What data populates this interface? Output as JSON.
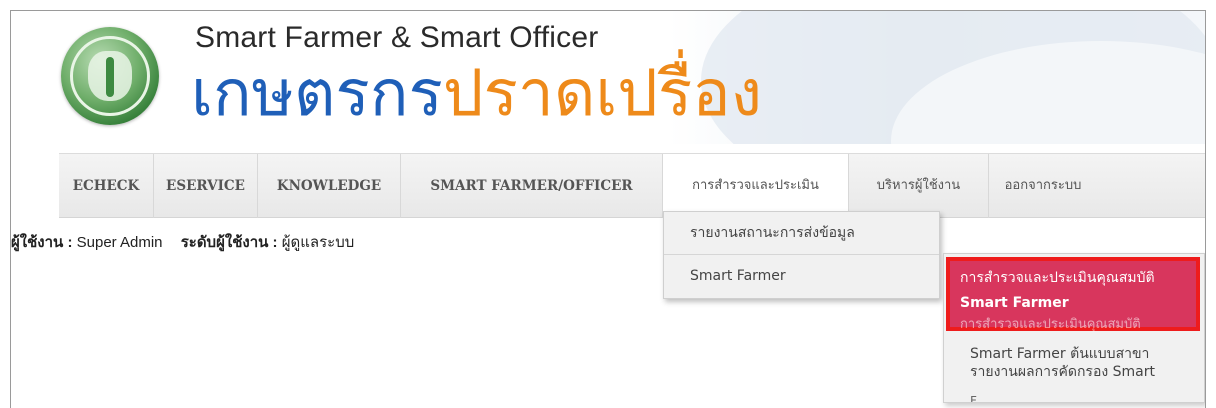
{
  "header": {
    "title_en": "Smart Farmer & Smart Officer",
    "title_th_part1": "เกษตรกร",
    "title_th_part2": "ปราดเปรื่อง",
    "logo_icon": "agriculture-department-seal-icon"
  },
  "nav": {
    "items": [
      {
        "label": "ECHECK"
      },
      {
        "label": "ESERVICE"
      },
      {
        "label": "KNOWLEDGE"
      },
      {
        "label": "SMART FARMER/OFFICER"
      },
      {
        "label": "การสำรวจและประเมิน"
      },
      {
        "label": "บริหารผู้ใช้งาน"
      },
      {
        "label": "ออกจากระบบ"
      }
    ]
  },
  "user": {
    "user_label": "ผู้ใช้งาน :",
    "user_value": "Super Admin",
    "level_label": "ระดับผู้ใช้งาน :",
    "level_value": "ผู้ดูแลระบบ"
  },
  "dropdown": {
    "items": [
      {
        "label": "รายงานสถานะการส่งข้อมูล"
      },
      {
        "label": "Smart Farmer"
      }
    ]
  },
  "submenu": {
    "highlighted_line1": "การสำรวจและประเมินคุณสมบัติ",
    "highlighted_line2": "Smart Farmer",
    "ghost_line": "การสำรวจและประเมินคุณสมบัติ",
    "item2": "Smart Farmer ต้นแบบสาขา",
    "item3": "รายงานผลการคัดกรอง Smart",
    "tail": "F",
    "highlight_color": "#d8365d",
    "annotation_color": "#ee1c1c"
  }
}
